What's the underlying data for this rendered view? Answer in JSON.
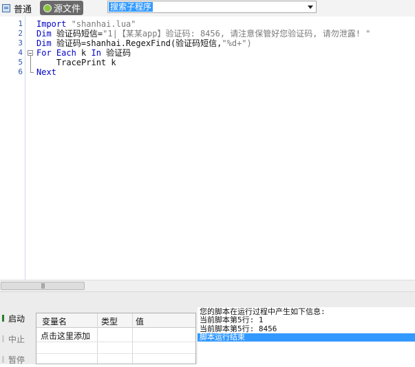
{
  "toolbar": {
    "tab_normal": {
      "label": "普通",
      "icon": "document-icon"
    },
    "tab_source": {
      "label": "源文件",
      "icon": "source-file-icon"
    },
    "sub_dropdown": {
      "value": "搜索子程序"
    }
  },
  "editor": {
    "line_numbers": [
      "1",
      "2",
      "3",
      "4",
      "5",
      "6"
    ],
    "lines": [
      {
        "kw": "Import ",
        "rest": "",
        "str": "\"shanhai.lua\""
      },
      {
        "kw": "Dim ",
        "rest": "验证码短信=",
        "str": "\"1|【某某app】验证码: 8456, 请注意保管好您验证码, 请勿泄露! \""
      },
      {
        "kw": "Dim ",
        "rest": "验证码=shanhai.RegexFind(验证码短信,",
        "str": "\"%d+\")"
      },
      {
        "kw": "For Each ",
        "rest": "k ",
        "kw2": "In ",
        "rest2": "验证码"
      },
      {
        "indent": "    ",
        "rest": "TracePrint k"
      },
      {
        "kw": "Next"
      }
    ]
  },
  "run_controls": {
    "start": "启动",
    "stop": "中止",
    "pause": "暂停"
  },
  "variables": {
    "headers": [
      "变量名",
      "类型",
      "值"
    ],
    "add_row_text": "点击这里添加"
  },
  "output": {
    "lines": [
      "您的脚本在运行过程中产生如下信息:",
      "当前脚本第5行: 1",
      "当前脚本第5行: 8456",
      "脚本运行结束"
    ]
  },
  "colors": {
    "keyword": "#0000c8",
    "string": "#7a7a7a",
    "line_number": "#2b55a8",
    "selection": "#3399ff"
  }
}
